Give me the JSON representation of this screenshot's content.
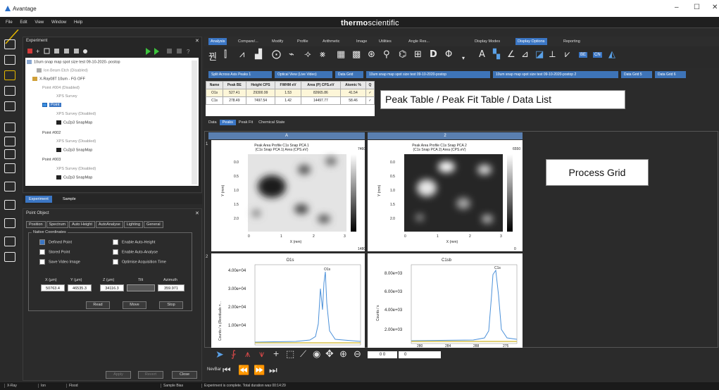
{
  "window": {
    "title": "Avantage",
    "min": "–",
    "max": "☐",
    "close": "✕"
  },
  "menu": [
    "File",
    "Edit",
    "View",
    "Window",
    "Help"
  ],
  "brand": {
    "left": "thermo",
    "right": "scientific"
  },
  "experiment_panel": {
    "title": "Experiment",
    "tree": [
      "10um snap map spot size test 09-10-2020- postop",
      "Ion Beam Etch (Disabled)",
      "X-Ray08T 10um - FG OFF",
      "Point #004 (Disabled)",
      "XPS Survey",
      "Point",
      "XPS Survey (Disabled)",
      "Cu2p3 SnapMap",
      "Point #002",
      "XPS Survey (Disabled)",
      "Cu2p3 SnapMap",
      "Point #003",
      "XPS Survey (Disabled)",
      "Cu2p3 SnapMap"
    ],
    "tabs": [
      "Experiment",
      "Sample"
    ]
  },
  "point_object": {
    "title": "Point Object",
    "tabs": [
      "Position",
      "Spectrum",
      "Auto Height",
      "AutoAnalyse",
      "Lighting",
      "General"
    ],
    "group_label": "Native Coordinates",
    "checks_left": [
      "Defined Point",
      "Stored Point",
      "Save Video Image"
    ],
    "checks_right": [
      "Enable Auto-Height",
      "Enable Auto-Analyse",
      "Optimise Acquisition Time"
    ],
    "field_labels": [
      "X (µm)",
      "Y (µm)",
      "Z (µm)",
      "Tilt",
      "Azimuth"
    ],
    "field_values": [
      "50763.4",
      "46535.3",
      "34116.3",
      "",
      "359.971"
    ],
    "buttons": [
      "Read",
      "Move",
      "Stop"
    ],
    "footer_buttons": [
      "Apply",
      "Revert",
      "Close"
    ]
  },
  "ribbon": {
    "tabs": [
      "Analysis",
      "Compare/...",
      "Modify",
      "Profile",
      "Arithmetic",
      "Image",
      "Utilities",
      "Angle Res...",
      "Display Modes",
      "Display Options",
      "Reporting"
    ],
    "active_tab": "Display Options",
    "small": [
      "BE",
      "CN"
    ]
  },
  "doc_tabs": [
    "Split Across Axis Peaks 1",
    "Optical View (Live Video)",
    "Data Grid",
    "10um snap map spot size test 09-10-2020-postop",
    "10um snap map spot size test 09-10-2020-postop 2",
    "Data Grid 5",
    "Data Grid 6"
  ],
  "peak_table": {
    "headers": [
      "Name",
      "Peak BE",
      "Height CPS",
      "FWHM eV",
      "Area (P) CPS.eV",
      "Atomic %",
      "Q"
    ],
    "rows": [
      [
        "O1s",
        "527.41",
        "29300.99",
        "1.53",
        "82665.86",
        "41.54",
        "✓"
      ],
      [
        "C1s",
        "278.49",
        "7497.54",
        "1.42",
        "14497.77",
        "58.46",
        "✓"
      ]
    ]
  },
  "annotations": {
    "peak_table": "Peak Table / Peak Fit Table / Data List",
    "process_grid": "Process Grid"
  },
  "sub_tabs": [
    "Data",
    "Peaks",
    "Peak Fit",
    "Chemical State"
  ],
  "active_sub_tab": "Peaks",
  "grid": {
    "columns": [
      "A",
      "2"
    ],
    "rows": [
      "1",
      "2"
    ],
    "maps": [
      {
        "title1": "Peak Area Profile C1s Snap PCA 1",
        "title2": "(C1s Snap PCA 1)   Area (CPS.eV)",
        "max": "7460",
        "min": "1480",
        "xlabel": "X (mm)",
        "ylabel": "Y (mm)",
        "yticks": [
          "0.0",
          "0.5",
          "1.0",
          "1.5",
          "2.0"
        ],
        "xticks": [
          "0",
          "1",
          "2",
          "3"
        ]
      },
      {
        "title1": "Peak Area Profile C1s Snap PCA 2",
        "title2": "(C1s Snap PCA 2)   Area (CPS.eV)",
        "max": "6550",
        "min": "0",
        "xlabel": "X (mm)",
        "ylabel": "Y (mm)",
        "yticks": [
          "0.0",
          "0.5",
          "1.0",
          "1.5",
          "2.0"
        ],
        "xticks": [
          "0",
          "1",
          "2",
          "3"
        ]
      }
    ],
    "spectra": [
      {
        "title": "O1s",
        "peak": "O1s",
        "ylabel": "Counts / s  (Residuals ×...",
        "yticks": [
          "4.00e+04",
          "3.00e+04",
          "2.00e+04",
          "1.00e+04"
        ]
      },
      {
        "title": "C1sb",
        "peak": "C1s",
        "ylabel": "Counts / s",
        "yticks": [
          "8.00e+03",
          "6.00e+03",
          "4.00e+03",
          "2.00e+03"
        ],
        "xticks": [
          "280",
          "284",
          "288",
          "275"
        ]
      }
    ]
  },
  "bottom": {
    "zoom_values": [
      "0 0",
      "0"
    ],
    "nav_label": "NevBar"
  },
  "status": [
    "X-Ray",
    "Ion",
    "Flood",
    "Sample Bias",
    "Experiment is complete. Total duration was 00:14:29"
  ],
  "colors": {
    "accent": "#3b76c4",
    "spectrum": "#4a90d9",
    "residual": "#d8c24a"
  }
}
